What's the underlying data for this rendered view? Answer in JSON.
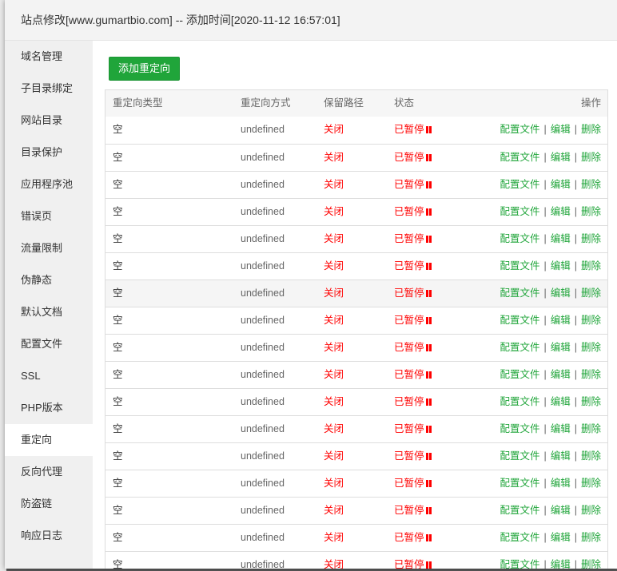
{
  "title": "站点修改[www.gumartbio.com] -- 添加时间[2020-11-12 16:57:01]",
  "sidebar": {
    "items": [
      {
        "label": "域名管理"
      },
      {
        "label": "子目录绑定"
      },
      {
        "label": "网站目录"
      },
      {
        "label": "目录保护"
      },
      {
        "label": "应用程序池"
      },
      {
        "label": "错误页"
      },
      {
        "label": "流量限制"
      },
      {
        "label": "伪静态"
      },
      {
        "label": "默认文档"
      },
      {
        "label": "配置文件"
      },
      {
        "label": "SSL"
      },
      {
        "label": "PHP版本"
      },
      {
        "label": "重定向",
        "active": true
      },
      {
        "label": "反向代理"
      },
      {
        "label": "防盗链"
      },
      {
        "label": "响应日志"
      }
    ]
  },
  "toolbar": {
    "add_label": "添加重定向"
  },
  "table": {
    "headers": [
      "重定向类型",
      "重定向方式",
      "保留路径",
      "状态",
      "操作"
    ],
    "actions": {
      "config": "配置文件",
      "edit": "编辑",
      "delete": "删除",
      "separator": "|"
    },
    "rows": [
      {
        "type": "空",
        "method": "undefined",
        "keep_path": "关闭",
        "status": "已暂停"
      },
      {
        "type": "空",
        "method": "undefined",
        "keep_path": "关闭",
        "status": "已暂停"
      },
      {
        "type": "空",
        "method": "undefined",
        "keep_path": "关闭",
        "status": "已暂停"
      },
      {
        "type": "空",
        "method": "undefined",
        "keep_path": "关闭",
        "status": "已暂停"
      },
      {
        "type": "空",
        "method": "undefined",
        "keep_path": "关闭",
        "status": "已暂停"
      },
      {
        "type": "空",
        "method": "undefined",
        "keep_path": "关闭",
        "status": "已暂停"
      },
      {
        "type": "空",
        "method": "undefined",
        "keep_path": "关闭",
        "status": "已暂停",
        "highlighted": true
      },
      {
        "type": "空",
        "method": "undefined",
        "keep_path": "关闭",
        "status": "已暂停"
      },
      {
        "type": "空",
        "method": "undefined",
        "keep_path": "关闭",
        "status": "已暂停"
      },
      {
        "type": "空",
        "method": "undefined",
        "keep_path": "关闭",
        "status": "已暂停"
      },
      {
        "type": "空",
        "method": "undefined",
        "keep_path": "关闭",
        "status": "已暂停"
      },
      {
        "type": "空",
        "method": "undefined",
        "keep_path": "关闭",
        "status": "已暂停"
      },
      {
        "type": "空",
        "method": "undefined",
        "keep_path": "关闭",
        "status": "已暂停"
      },
      {
        "type": "空",
        "method": "undefined",
        "keep_path": "关闭",
        "status": "已暂停"
      },
      {
        "type": "空",
        "method": "undefined",
        "keep_path": "关闭",
        "status": "已暂停"
      },
      {
        "type": "空",
        "method": "undefined",
        "keep_path": "关闭",
        "status": "已暂停"
      },
      {
        "type": "空",
        "method": "undefined",
        "keep_path": "关闭",
        "status": "已暂停"
      }
    ]
  },
  "colors": {
    "accent": "#20a53a",
    "danger": "#ff0000",
    "sidebar_bg": "#f0f0f0"
  }
}
